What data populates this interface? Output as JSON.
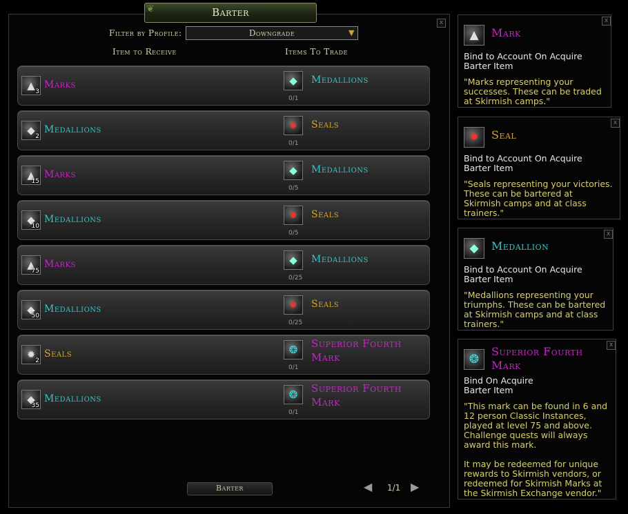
{
  "window": {
    "title": "Barter",
    "close_label": "x"
  },
  "filter": {
    "label": "Filter by Profile:",
    "value": "Downgrade"
  },
  "columns": {
    "receive": "Item to Receive",
    "trade": "Items To Trade"
  },
  "rows": [
    {
      "receive_qty": "3",
      "receive_name": "Marks",
      "trade_name": "Medallions",
      "trade_count": "0/1"
    },
    {
      "receive_qty": "2",
      "receive_name": "Medallions",
      "trade_name": "Seals",
      "trade_count": "0/1"
    },
    {
      "receive_qty": "15",
      "receive_name": "Marks",
      "trade_name": "Medallions",
      "trade_count": "0/5"
    },
    {
      "receive_qty": "10",
      "receive_name": "Medallions",
      "trade_name": "Seals",
      "trade_count": "0/5"
    },
    {
      "receive_qty": "75",
      "receive_name": "Marks",
      "trade_name": "Medallions",
      "trade_count": "0/25"
    },
    {
      "receive_qty": "50",
      "receive_name": "Medallions",
      "trade_name": "Seals",
      "trade_count": "0/25"
    },
    {
      "receive_qty": "2",
      "receive_name": "Seals",
      "trade_name": "Superior Fourth Mark",
      "trade_count": "0/1"
    },
    {
      "receive_qty": "35",
      "receive_name": "Medallions",
      "trade_name": "Superior Fourth Mark",
      "trade_count": "0/1"
    }
  ],
  "barter_button": "Barter",
  "pagination": {
    "text": "1/1"
  },
  "tooltips": [
    {
      "name": "Mark",
      "bind": "Bind to Account On Acquire",
      "type": "Barter Item",
      "desc": "\"Marks representing your\nsuccesses. These can be traded\nat Skirmish camps.\""
    },
    {
      "name": "Seal",
      "bind": "Bind to Account On Acquire",
      "type": "Barter Item",
      "desc": "\"Seals representing your victories.\nThese can be bartered at\nSkirmish camps and at class\ntrainers.\""
    },
    {
      "name": "Medallion",
      "bind": "Bind to Account On Acquire",
      "type": "Barter Item",
      "desc": "\"Medallions representing your\ntriumphs. These can be bartered\nat Skirmish camps and at class\ntrainers.\""
    },
    {
      "name": "Superior Fourth Mark",
      "bind": "Bind On Acquire",
      "type": "Barter Item",
      "desc": "\"This mark can be found in 6 and\n12 person Classic Instances,\nplayed at level 75 and above.\nChallenge quests will always\naward this mark.\n\nIt may be redeemed for unique\nrewards to Skirmish vendors, or\nredeemed for Skirmish Marks at\nthe Skirmish Exchange vendor.\""
    }
  ],
  "colors": {
    "mark": "#c427c4",
    "medallion": "#36c6c6",
    "seal": "#d8a530"
  },
  "icons": {
    "mark": "mark-icon",
    "medallion": "medallion-icon",
    "seal": "seal-icon",
    "superior_fourth_mark": "superior-fourth-mark-icon"
  }
}
